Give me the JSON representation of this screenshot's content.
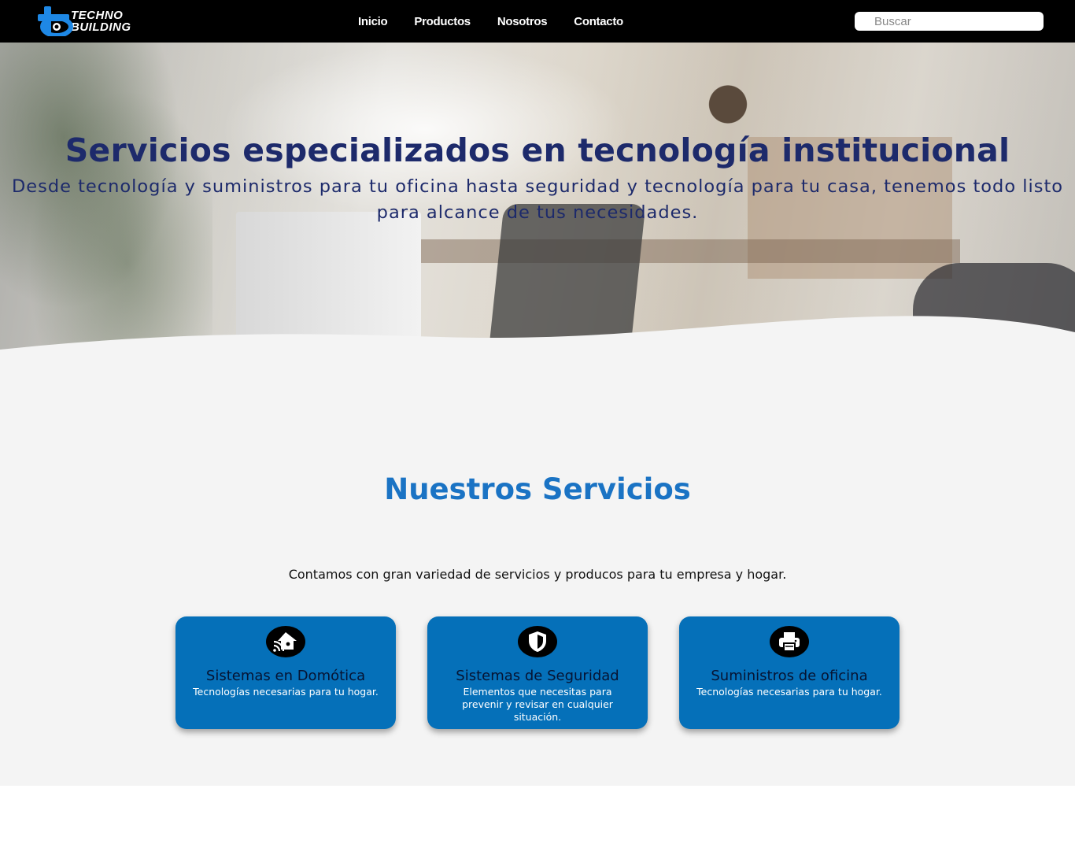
{
  "brand": {
    "line1": "TECHNO",
    "line2": "BUILDING",
    "accent_color": "#1e88e5"
  },
  "nav": {
    "items": [
      {
        "label": "Inicio"
      },
      {
        "label": "Productos"
      },
      {
        "label": "Nosotros"
      },
      {
        "label": "Contacto"
      }
    ],
    "search_placeholder": "Buscar"
  },
  "hero": {
    "title": "Servicios especializados en tecnología institucional",
    "subtitle": "Desde tecnología y suministros para tu oficina hasta seguridad y tecnología para tu casa, tenemos todo listo para alcance de tus necesidades.",
    "text_color": "#1d2a6b"
  },
  "services": {
    "title": "Nuestros Servicios",
    "intro": "Contamos con gran variedad de servicios y producos para tu empresa y hogar.",
    "card_color": "#0570b9",
    "cards": [
      {
        "icon": "smart-home-icon",
        "title": "Sistemas en Domótica",
        "description": "Tecnologías necesarias para tu hogar."
      },
      {
        "icon": "shield-icon",
        "title": "Sistemas de Seguridad",
        "description": "Elementos que necesitas para prevenir y revisar en cualquier situación."
      },
      {
        "icon": "printer-icon",
        "title": "Suministros de oficina",
        "description": "Tecnologías necesarias para tu hogar."
      }
    ]
  }
}
